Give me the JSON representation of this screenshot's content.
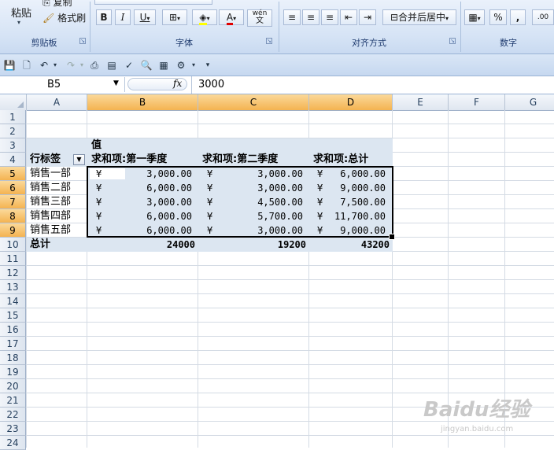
{
  "ribbon": {
    "clipboard": {
      "paste": "粘贴",
      "copy": "复制",
      "format_painter": "格式刷",
      "group": "剪贴板"
    },
    "font": {
      "bold": "B",
      "italic": "I",
      "underline": "U",
      "font_color": "A",
      "phonetic_top": "wén",
      "phonetic_bottom": "文",
      "group": "字体"
    },
    "alignment": {
      "merge_center": "合并后居中",
      "group": "对齐方式"
    },
    "number": {
      "percent": "%",
      "comma": ",",
      "group": "数字"
    }
  },
  "formula_bar": {
    "name_box": "B5",
    "fx": "fx",
    "value": "3000"
  },
  "columns": [
    "A",
    "B",
    "C",
    "D",
    "E",
    "F",
    "G"
  ],
  "rows": [
    "1",
    "2",
    "3",
    "4",
    "5",
    "6",
    "7",
    "8",
    "9",
    "10",
    "11",
    "12",
    "13",
    "14",
    "15",
    "16",
    "17",
    "18",
    "19",
    "20",
    "21",
    "22",
    "23",
    "24"
  ],
  "pivot": {
    "values_caption": "值",
    "row_label_header": "行标签",
    "col_headers": [
      "求和项:第一季度",
      "求和项:第二季度",
      "求和项:总计"
    ],
    "rows": [
      {
        "label": "销售一部",
        "q1": "3,000.00",
        "q2": "3,000.00",
        "total": "6,000.00"
      },
      {
        "label": "销售二部",
        "q1": "6,000.00",
        "q2": "3,000.00",
        "total": "9,000.00"
      },
      {
        "label": "销售三部",
        "q1": "3,000.00",
        "q2": "4,500.00",
        "total": "7,500.00"
      },
      {
        "label": "销售四部",
        "q1": "6,000.00",
        "q2": "5,700.00",
        "total": "11,700.00"
      },
      {
        "label": "销售五部",
        "q1": "6,000.00",
        "q2": "3,000.00",
        "total": "9,000.00"
      }
    ],
    "currency_symbol": "¥",
    "grand_total": {
      "label": "总计",
      "q1": "24000",
      "q2": "19200",
      "total": "43200"
    }
  },
  "watermark": {
    "brand": "Baidu经验",
    "url": "jingyan.baidu.com"
  }
}
